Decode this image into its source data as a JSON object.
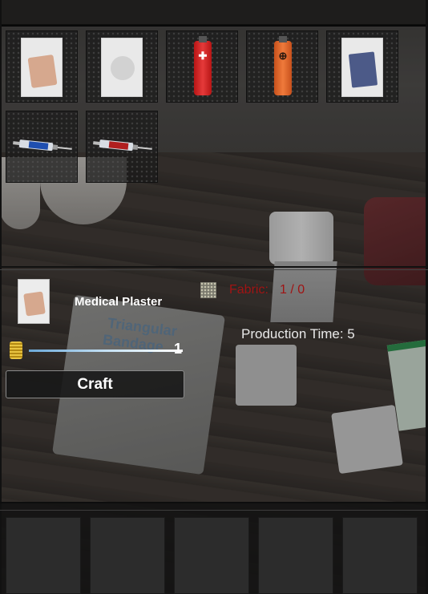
{
  "inventory": {
    "items": [
      {
        "name": "Medical Plaster"
      },
      {
        "name": "Gauze"
      },
      {
        "name": "Red Ointment Tube"
      },
      {
        "name": "Orange Ointment Tube"
      },
      {
        "name": "Blue Pad"
      },
      {
        "name": "Syringe Blue"
      },
      {
        "name": "Syringe Red"
      }
    ]
  },
  "craft": {
    "item_name": "Medical Plaster",
    "requirement_label": "Fabric:",
    "requirement_count": "1 / 0",
    "production_time": "Production Time: 5",
    "quantity": "1",
    "craft_button": "Craft"
  },
  "colors": {
    "requirement_missing": "#a01414",
    "slider": "#6ba8d8",
    "coin": "#d9ad21"
  },
  "scene_text": {
    "bag_line1": "Triangular",
    "bag_line2": "Bandage"
  }
}
